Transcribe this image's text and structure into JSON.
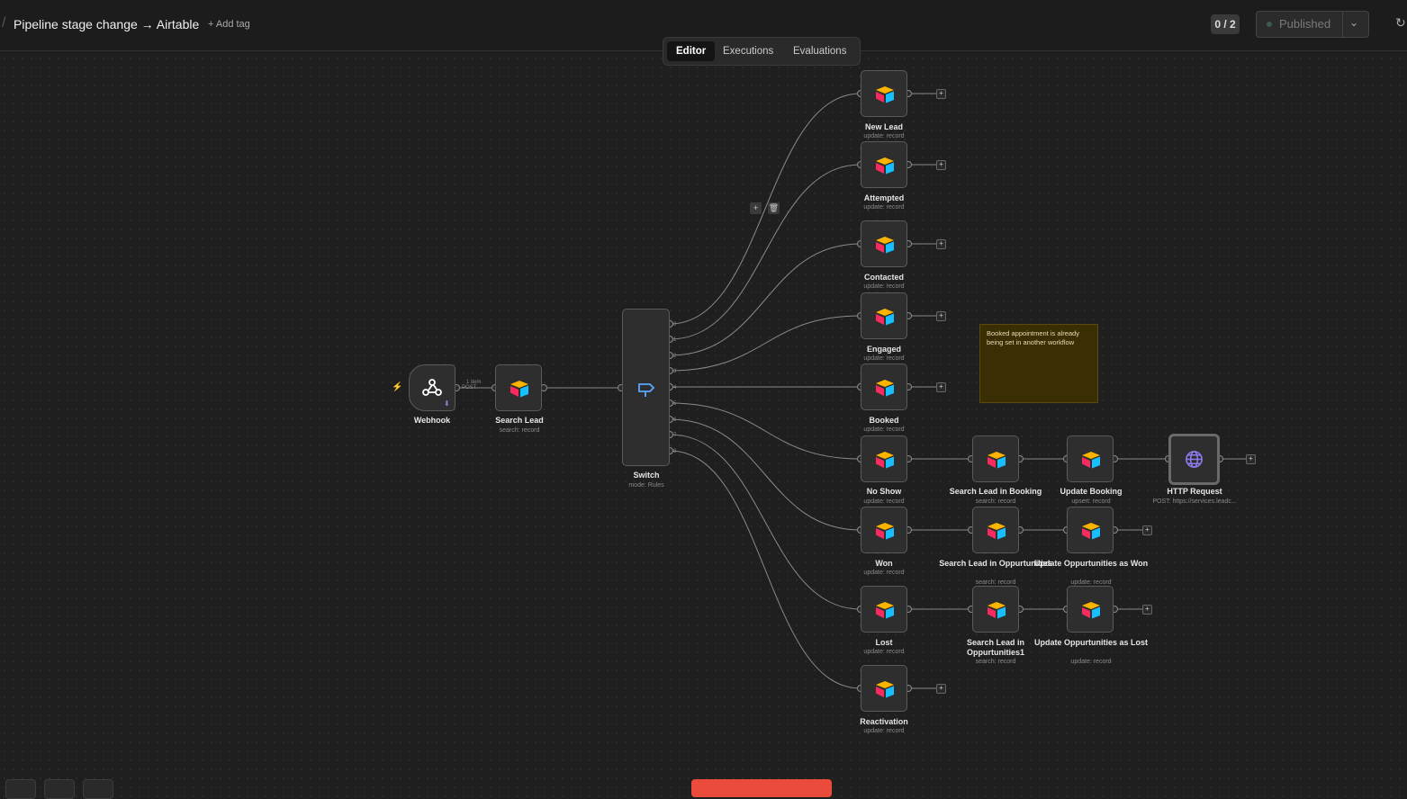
{
  "header": {
    "workflow_title": "Pipeline stage change → Airtable",
    "add_tag": "+ Add tag",
    "counter": "0 / 2",
    "publish_label": "Published"
  },
  "tabs": [
    "Editor",
    "Executions",
    "Evaluations"
  ],
  "active_tab": "Editor",
  "colors": {
    "canvas": "#1f1f1f",
    "node_bg": "#2e2e2e",
    "edge": "#8a8a8a",
    "note_bg": "#3a2e05",
    "trigger": "#e84a3c",
    "accent_red": "#ea4b3a"
  },
  "nodes": {
    "webhook": {
      "label": "Webhook",
      "icon": "webhook-icon"
    },
    "search_lead": {
      "label": "Search Lead",
      "sub": "search: record",
      "icon": "airtable-icon"
    },
    "switch": {
      "label": "Switch",
      "sub": "mode: Rules",
      "icon": "switch-icon"
    },
    "new_lead": {
      "label": "New Lead",
      "sub": "update: record"
    },
    "attempted": {
      "label": "Attempted",
      "sub": "update: record"
    },
    "contacted": {
      "label": "Contacted",
      "sub": "update: record"
    },
    "engaged": {
      "label": "Engaged",
      "sub": "update: record"
    },
    "booked": {
      "label": "Booked",
      "sub": "update: record"
    },
    "no_show": {
      "label": "No Show",
      "sub": "update: record"
    },
    "won": {
      "label": "Won",
      "sub": "update: record"
    },
    "lost": {
      "label": "Lost",
      "sub": "update: record"
    },
    "reactivation": {
      "label": "Reactivation",
      "sub": "update: record"
    },
    "search_booking": {
      "label": "Search Lead in Booking",
      "sub": "search: record"
    },
    "update_booking": {
      "label": "Update Booking",
      "sub": "upsert: record"
    },
    "http_request": {
      "label": "HTTP Request",
      "sub": "POST: https://services.leadc..."
    },
    "search_opp": {
      "label": "Search Lead in Oppurtunities",
      "sub": "search: record"
    },
    "update_opp_won": {
      "label": "Update Oppurtunities as Won",
      "sub": "update: record"
    },
    "search_opp1": {
      "label": "Search Lead in Oppurtunities1",
      "sub": "search: record"
    },
    "update_opp_lost": {
      "label": "Update Oppurtunities as Lost",
      "sub": "update: record"
    }
  },
  "edge_label": {
    "items": "1 item",
    "method": "POST"
  },
  "switch_outputs": [
    "0",
    "1",
    "2",
    "3",
    "4",
    "5",
    "6",
    "7",
    "8"
  ],
  "sticky_note": "Booked appointment is already being set in another workflow"
}
